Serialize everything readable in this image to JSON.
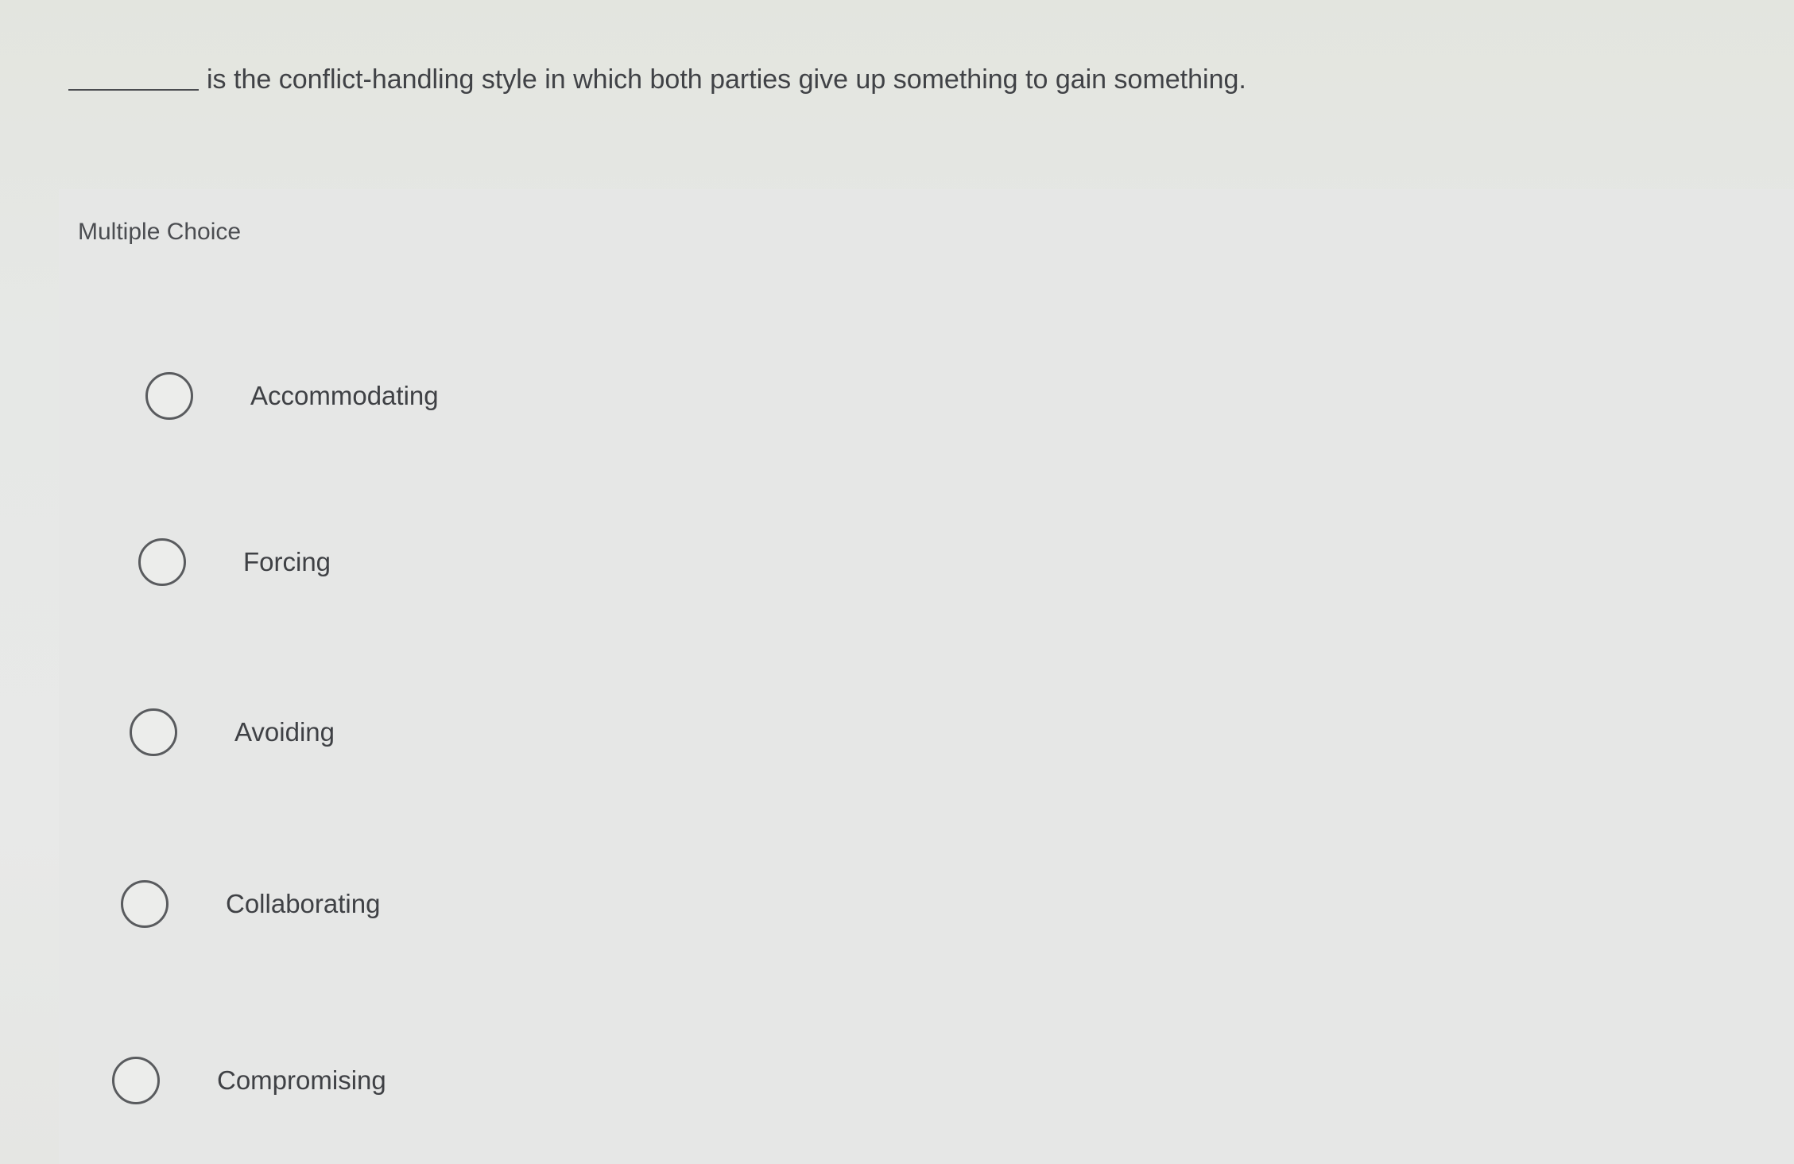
{
  "question": {
    "blank": "__________",
    "text": "is the conflict-handling style in which both parties give up something to gain something."
  },
  "panel": {
    "label": "Multiple Choice"
  },
  "options": [
    {
      "label": "Accommodating"
    },
    {
      "label": "Forcing"
    },
    {
      "label": "Avoiding"
    },
    {
      "label": "Collaborating"
    },
    {
      "label": "Compromising"
    }
  ]
}
